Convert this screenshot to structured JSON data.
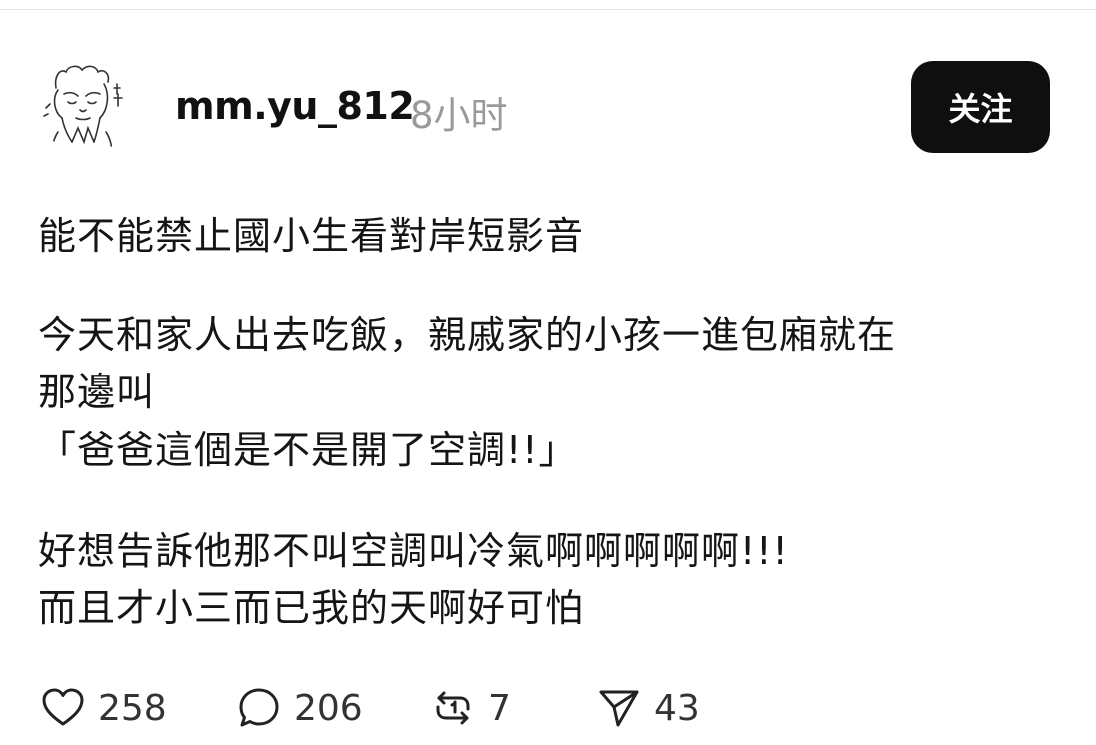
{
  "post": {
    "author": {
      "username": "mm.yu_812",
      "time_ago": "8小时",
      "avatar_icon": "hand-drawn-avatar-icon"
    },
    "follow_label": "关注",
    "title": "能不能禁止國小生看對岸短影音",
    "lines": [
      "今天和家人出去吃飯，親戚家的小孩一進包廂就在",
      "那邊叫",
      "「爸爸這個是不是開了空調!!」",
      "好想告訴他那不叫空調叫冷氣啊啊啊啊啊!!!",
      "而且才小三而已我的天啊好可怕"
    ],
    "actions": {
      "like": {
        "icon": "heart-icon",
        "count": "258"
      },
      "reply": {
        "icon": "comment-icon",
        "count": "206"
      },
      "repost": {
        "icon": "repost-icon",
        "count": "7"
      },
      "share": {
        "icon": "send-icon",
        "count": "43"
      }
    }
  },
  "colors": {
    "follow_button_bg": "#0f0f0f",
    "timestamp": "#9a9a9a"
  }
}
